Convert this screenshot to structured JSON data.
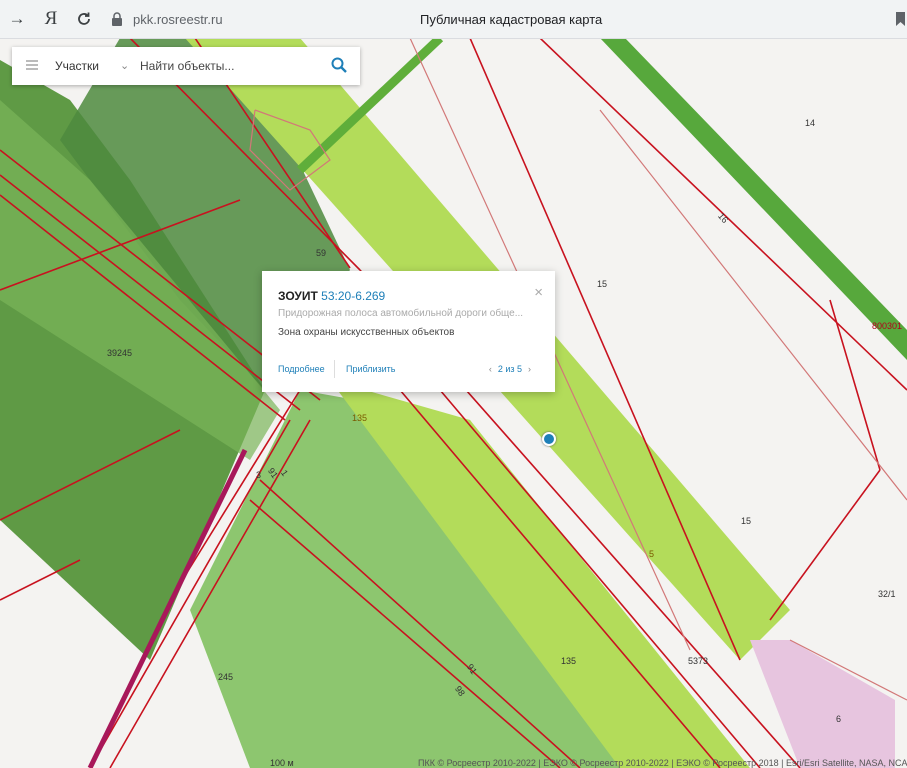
{
  "browser": {
    "nav_glyphs": {
      "forward": "→",
      "yandex": "Я"
    },
    "url": "pkk.rosreestr.ru",
    "page_title": "Публичная кадастровая карта"
  },
  "search": {
    "category": "Участки",
    "placeholder": "Найти объекты..."
  },
  "popup": {
    "type": "ЗОУИТ",
    "number": "53:20-6.269",
    "description": "Придорожная полоса автомобильной дороги обще...",
    "zone": "Зона охраны искусственных объектов",
    "more_link": "Подробнее",
    "zoom_link": "Приблизить",
    "pager": "2 из 5",
    "close_glyph": "×",
    "prev_glyph": "‹",
    "next_glyph": "›"
  },
  "map_labels": {
    "l14": "14",
    "l16": "16",
    "l15a": "15",
    "l800301": "800301",
    "l59": "59",
    "l39245": "39245",
    "l135a": "135",
    "l15b": "15",
    "l5": "5",
    "l32": "32/1",
    "l135b": "135",
    "l5373": "5373",
    "l245": "245",
    "l6": "6",
    "l91a": "91",
    "l91b": "91",
    "l98": "98",
    "l1": "1",
    "l3": "3",
    "scale": "100 м",
    "attribution": "ПКК © Росреестр 2010-2022 | ЕЭКО © Росреестр 2010-2022 | ЕЭКО © Росреестр 2018 | Esri/Esri Satellite, NASA, NCA, NMI..."
  },
  "colors": {
    "dark_green": "#5f9a45",
    "light_green": "#b3dc5a",
    "mid_green": "#8dc66f",
    "parcel_line": "#c8121f",
    "link": "#1e7fb8",
    "pink_zone": "#e7c5df"
  },
  "icons": [
    "forward-icon",
    "yandex-icon",
    "reload-icon",
    "lock-icon",
    "bookmark-icon",
    "menu-icon",
    "chevron-down-icon",
    "search-icon",
    "close-icon",
    "location-marker-icon"
  ]
}
